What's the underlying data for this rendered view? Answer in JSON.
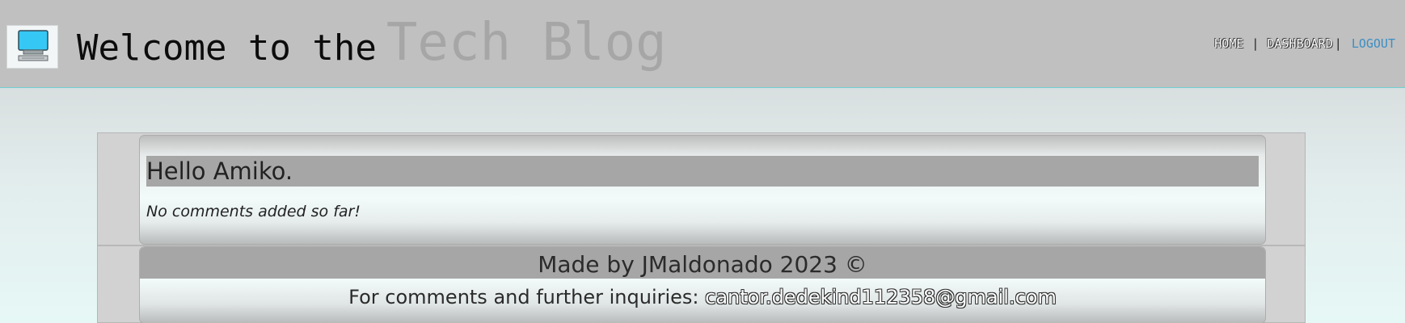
{
  "header": {
    "title_prefix": "Welcome to the",
    "title_brand": "Tech Blog",
    "logo_icon": "computer-monitor-icon",
    "nav": {
      "home": "HOME",
      "dashboard": "DASHBOARD",
      "logout": "LOGOUT",
      "separator": "|"
    }
  },
  "main": {
    "card": {
      "title": "Hello Amiko.",
      "body": "No comments added so far!"
    }
  },
  "footer": {
    "made_by": "Made by JMaldonado 2023 ©",
    "contact_label": "For comments and further inquiries:",
    "contact_email": "cantor.dedekind112358@gmail.com"
  },
  "colors": {
    "header_bg": "#c0c0c0",
    "brand_gray": "#a6a6a6",
    "logout_link": "#3c8ec4",
    "monitor_screen": "#36c8f4"
  }
}
